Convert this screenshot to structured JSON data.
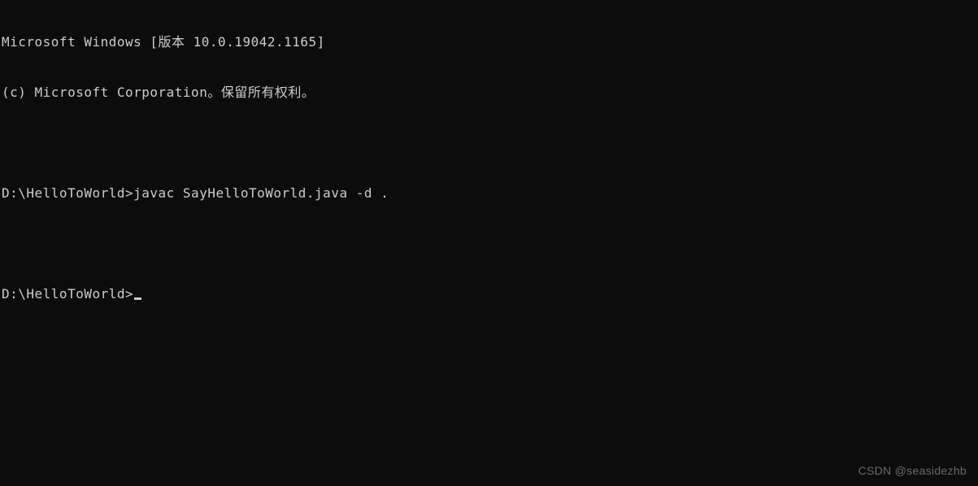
{
  "terminal": {
    "header_line1": "Microsoft Windows [版本 10.0.19042.1165]",
    "header_line2": "(c) Microsoft Corporation。保留所有权利。",
    "blank": "",
    "prompt1_path": "D:\\HelloToWorld>",
    "prompt1_command": "javac SayHelloToWorld.java -d .",
    "prompt2_path": "D:\\HelloToWorld>",
    "prompt2_command": ""
  },
  "watermark": "CSDN @seasidezhb"
}
